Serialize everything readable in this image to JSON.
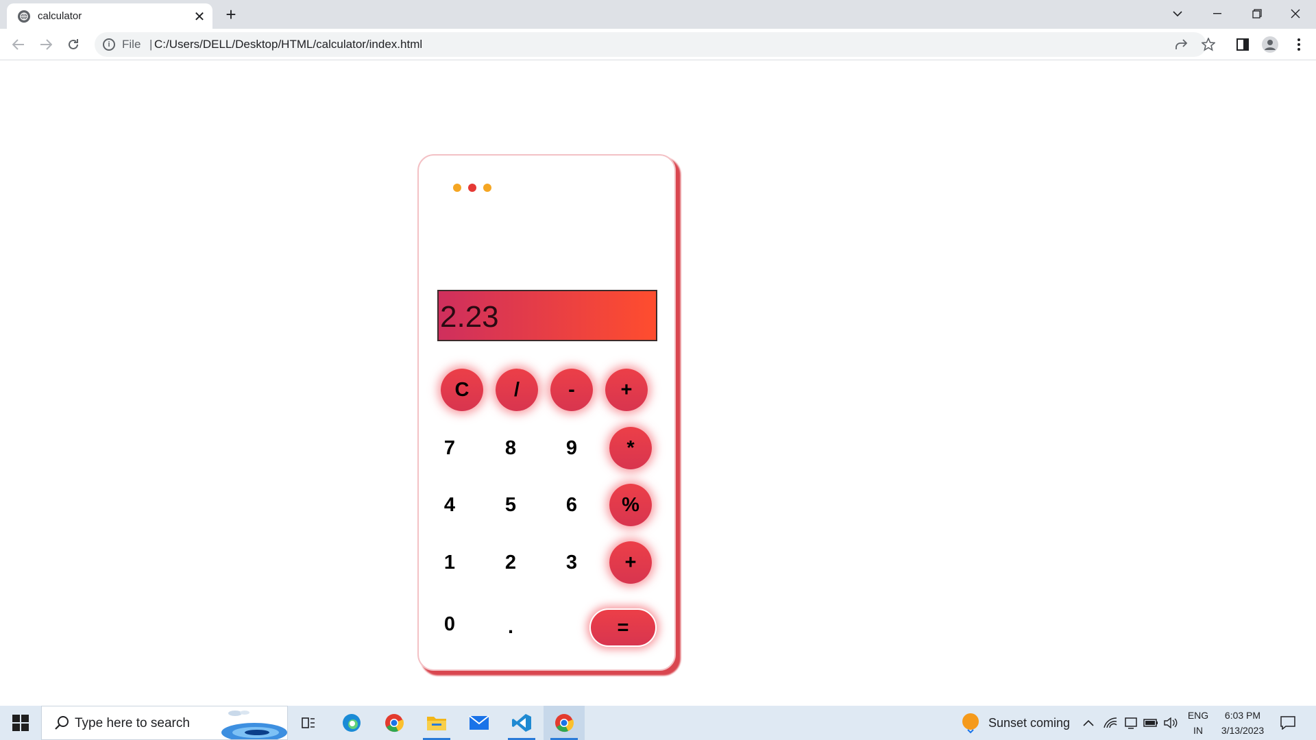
{
  "browser": {
    "tab_title": "calculator",
    "close_symbol": "✕",
    "new_tab_symbol": "+",
    "file_label": "File",
    "separator": "|",
    "url": "C:/Users/DELL/Desktop/HTML/calculator/index.html"
  },
  "calculator": {
    "display_value": "2.23",
    "dot_colors": [
      "#f5a623",
      "#e53935",
      "#f5a623"
    ],
    "top_row": [
      "C",
      "/",
      "-",
      "+"
    ],
    "rows": [
      {
        "digits": [
          "7",
          "8",
          "9"
        ],
        "op": "*"
      },
      {
        "digits": [
          "4",
          "5",
          "6"
        ],
        "op": "%"
      },
      {
        "digits": [
          "1",
          "2",
          "3"
        ],
        "op": "+"
      }
    ],
    "bottom_row": {
      "zero": "0",
      "dot": ".",
      "equals": "="
    },
    "accent_colors": {
      "display_start": "#cf2f5d",
      "display_end": "#ff4d2e",
      "button": "#e23a4d",
      "shadow": "#d9464f"
    }
  },
  "taskbar": {
    "search_placeholder": "Type here to search",
    "weather_text": "Sunset coming",
    "lang_top": "ENG",
    "lang_bottom": "IN",
    "time": "6:03 PM",
    "date": "3/13/2023"
  }
}
